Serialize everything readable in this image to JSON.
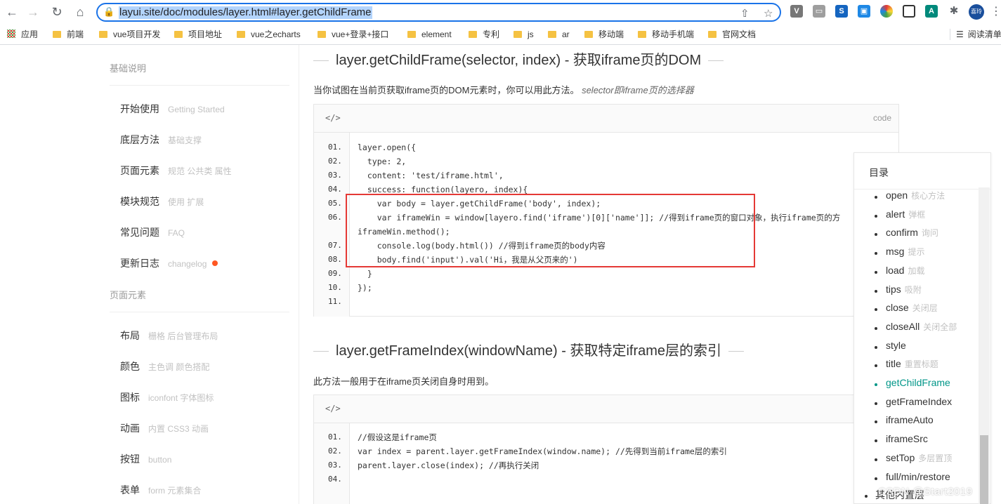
{
  "browser": {
    "url": "layui.site/doc/modules/layer.html#layer.getChildFrame",
    "avatar_text": "喜玲",
    "bookmarks": [
      "应用",
      "前端",
      "vue项目开发",
      "项目地址",
      "vue之echarts",
      "vue+登录+接口",
      "element",
      "专利",
      "js",
      "ar",
      "移动端",
      "移动手机端",
      "官网文档"
    ],
    "reading_list": "阅读清单"
  },
  "left_nav": {
    "group1": "基础说明",
    "group1_items": [
      {
        "label": "开始使用",
        "sub": "Getting Started"
      },
      {
        "label": "底层方法",
        "sub": "基础支撑"
      },
      {
        "label": "页面元素",
        "sub": "规范 公共类 属性"
      },
      {
        "label": "模块规范",
        "sub": "使用 扩展"
      },
      {
        "label": "常见问题",
        "sub": "FAQ"
      },
      {
        "label": "更新日志",
        "sub": "changelog"
      }
    ],
    "group2": "页面元素",
    "group2_items": [
      {
        "label": "布局",
        "sub": "栅格 后台管理布局"
      },
      {
        "label": "颜色",
        "sub": "主色调 颜色搭配"
      },
      {
        "label": "图标",
        "sub": "iconfont 字体图标"
      },
      {
        "label": "动画",
        "sub": "内置 CSS3 动画"
      },
      {
        "label": "按钮",
        "sub": "button"
      },
      {
        "label": "表单",
        "sub": "form 元素集合"
      }
    ]
  },
  "content": {
    "section1": {
      "title": "layer.getChildFrame(selector, index) - 获取iframe页的DOM",
      "desc": "当你试图在当前页获取iframe页的DOM元素时，你可以用此方法。",
      "desc_em": "selector即iframe页的选择器",
      "code_tag": "</>",
      "code_label": "code",
      "lines": [
        {
          "n": "01.",
          "t": "layer.open({"
        },
        {
          "n": "02.",
          "t": "  type: 2,"
        },
        {
          "n": "03.",
          "t": "  content: 'test/iframe.html',"
        },
        {
          "n": "04.",
          "t": "  success: function(layero, index){"
        },
        {
          "n": "05.",
          "t": "    var body = layer.getChildFrame('body', index);"
        },
        {
          "n": "06.",
          "t": "    var iframeWin = window[layero.find('iframe')[0]['name']]; //得到iframe页的窗口对象，执行iframe页的方"
        },
        {
          "n": "",
          "t": "iframeWin.method();"
        },
        {
          "n": "07.",
          "t": "    console.log(body.html()) //得到iframe页的body内容"
        },
        {
          "n": "08.",
          "t": "    body.find('input').val('Hi，我是从父页来的')"
        },
        {
          "n": "09.",
          "t": "  }"
        },
        {
          "n": "10.",
          "t": "});"
        },
        {
          "n": "11.",
          "t": ""
        }
      ]
    },
    "section2": {
      "title": "layer.getFrameIndex(windowName) - 获取特定iframe层的索引",
      "desc": "此方法一般用于在iframe页关闭自身时用到。",
      "code_tag": "</>",
      "lines": [
        {
          "n": "01.",
          "t": "//假设这是iframe页"
        },
        {
          "n": "02.",
          "t": "var index = parent.layer.getFrameIndex(window.name); //先得到当前iframe层的索引"
        },
        {
          "n": "03.",
          "t": "parent.layer.close(index); //再执行关闭"
        },
        {
          "n": "04.",
          "t": ""
        }
      ]
    }
  },
  "toc": {
    "title": "目录",
    "items": [
      {
        "label": "open",
        "sub": "核心方法"
      },
      {
        "label": "alert",
        "sub": "弹框"
      },
      {
        "label": "confirm",
        "sub": "询问"
      },
      {
        "label": "msg",
        "sub": "提示"
      },
      {
        "label": "load",
        "sub": "加载"
      },
      {
        "label": "tips",
        "sub": "吸附"
      },
      {
        "label": "close",
        "sub": "关闭层"
      },
      {
        "label": "closeAll",
        "sub": "关闭全部"
      },
      {
        "label": "style",
        "sub": ""
      },
      {
        "label": "title",
        "sub": "重置标题"
      },
      {
        "label": "getChildFrame",
        "sub": ""
      },
      {
        "label": "getFrameIndex",
        "sub": ""
      },
      {
        "label": "iframeAuto",
        "sub": ""
      },
      {
        "label": "iframeSrc",
        "sub": ""
      },
      {
        "label": "setTop",
        "sub": "多层置顶"
      },
      {
        "label": "full/min/restore",
        "sub": ""
      }
    ],
    "active_index": 10,
    "other": "其他内置层"
  },
  "watermark": "CSDN @Start2019",
  "colors": {
    "accent": "#009688",
    "highlight": "#e53935",
    "dot": "#ff5722"
  }
}
